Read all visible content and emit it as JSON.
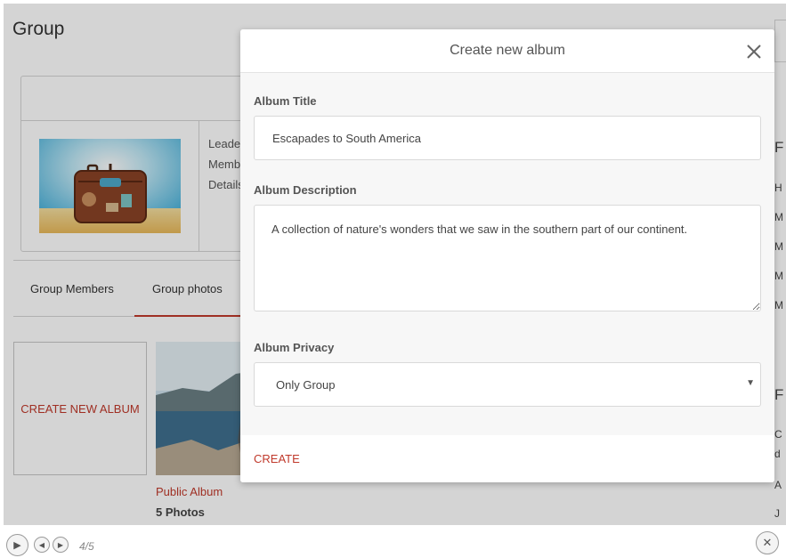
{
  "page": {
    "title": "Group"
  },
  "group_card": {
    "info_labels": [
      "Leade",
      "Memb",
      "Details"
    ]
  },
  "tabs": [
    {
      "label": "Group Members"
    },
    {
      "label": "Group photos"
    }
  ],
  "albums": {
    "create_tile_label": "CREATE NEW ALBUM",
    "items": [
      {
        "name": "Public Album",
        "count": "5 Photos"
      }
    ]
  },
  "right_column": {
    "texts": [
      "F",
      "H",
      "M",
      "M",
      "M",
      "M",
      "F",
      "C",
      "d",
      "A",
      "J"
    ]
  },
  "modal": {
    "title": "Create new album",
    "album_title_label": "Album Title",
    "album_title_value": "Escapades to South America",
    "album_description_label": "Album Description",
    "album_description_value": "A collection of nature's wonders that we saw in the southern part of our continent.",
    "album_privacy_label": "Album Privacy",
    "album_privacy_value": "Only Group",
    "create_label": "CREATE"
  },
  "player": {
    "counter": "4/5"
  },
  "colors": {
    "accent": "#c0392b",
    "overlay": "rgba(0,0,0,0.17)",
    "modal_bg": "#f7f7f7"
  }
}
